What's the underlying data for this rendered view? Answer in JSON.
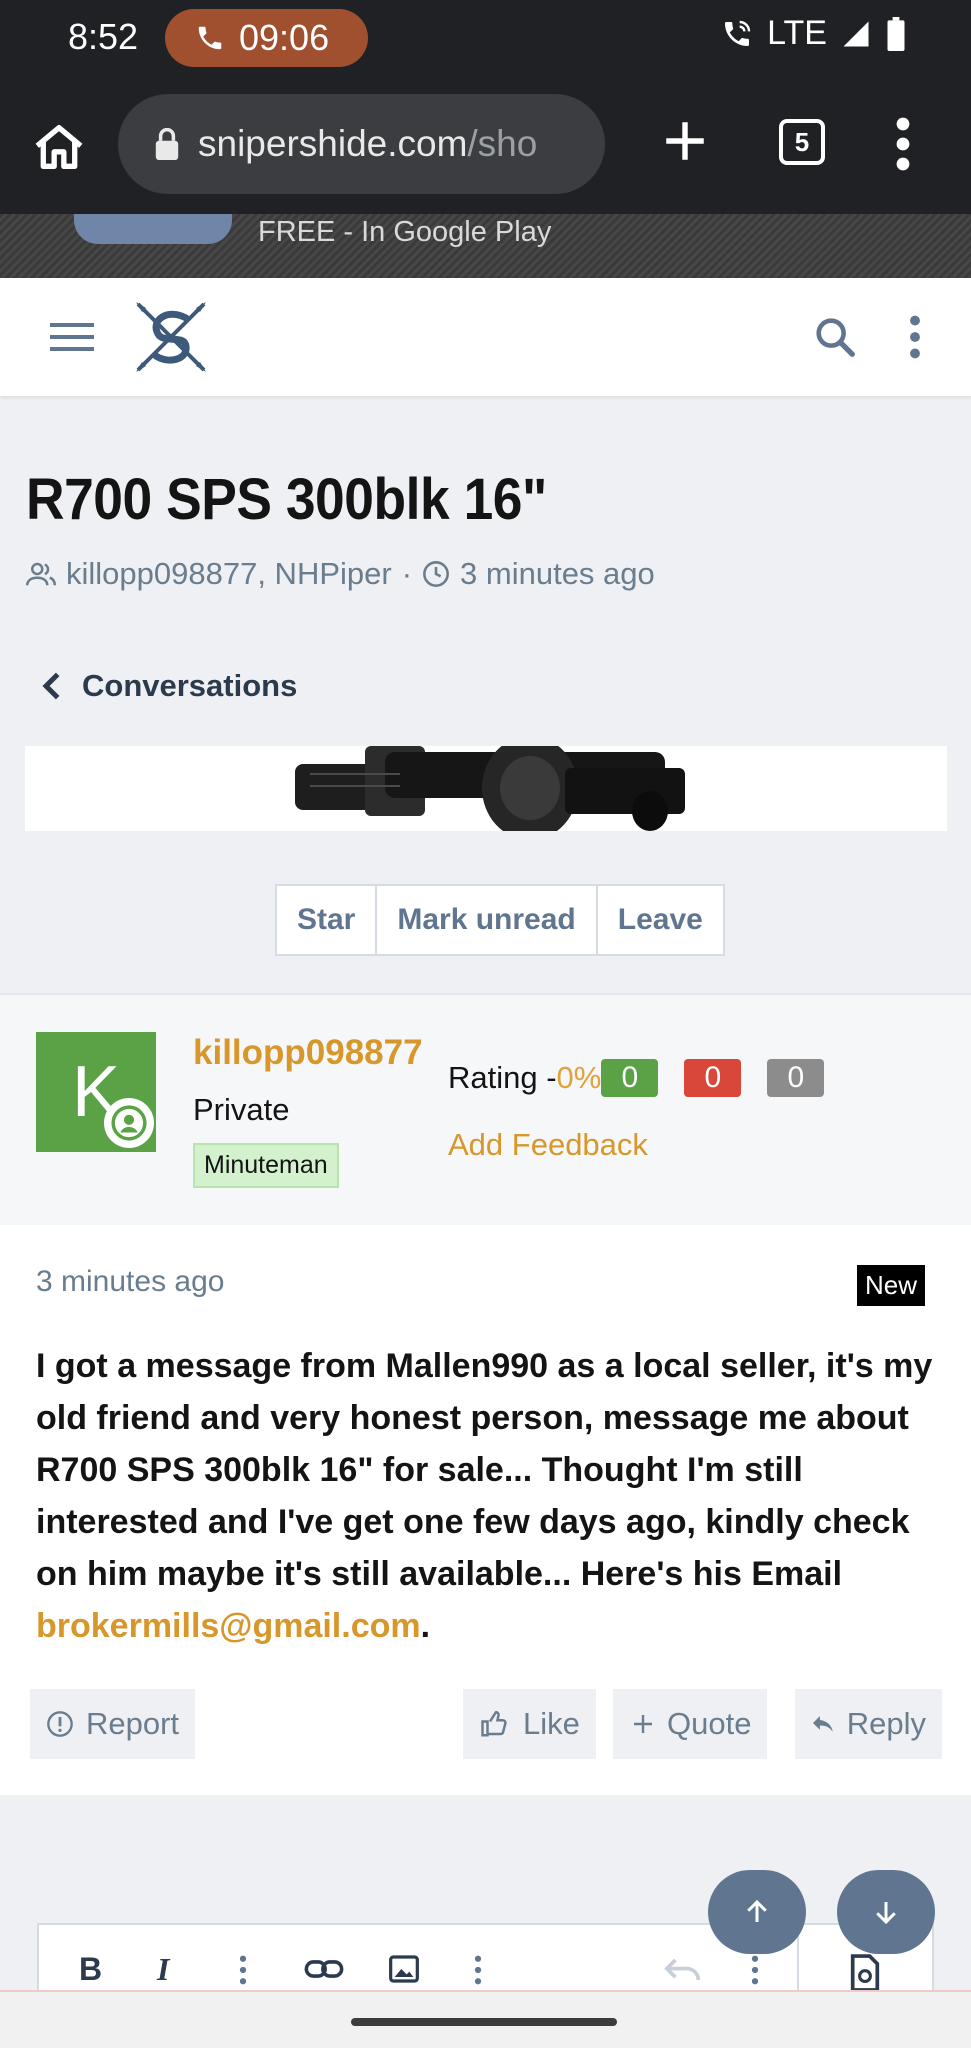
{
  "status_bar": {
    "time": "8:52",
    "call_time": "09:06",
    "network": "LTE"
  },
  "browser": {
    "url_host": "snipershide.com",
    "url_rest": "/sho",
    "tab_count": "5"
  },
  "ad": {
    "text": "FREE - In Google Play"
  },
  "thread": {
    "title": "R700 SPS 300blk 16\"",
    "participants": "killopp098877, NHPiper",
    "separator": "·",
    "time": "3 minutes ago",
    "back_label": "Conversations",
    "buttons": {
      "star": "Star",
      "mark_unread": "Mark unread",
      "leave": "Leave"
    }
  },
  "post": {
    "avatar_letter": "K",
    "username": "killopp098877",
    "rank": "Private",
    "banner": "Minuteman",
    "rating_label": "Rating -",
    "rating_pct": "0%",
    "rating_counts": {
      "positive": "0",
      "negative": "0",
      "neutral": "0"
    },
    "add_feedback": "Add Feedback",
    "time": "3 minutes ago",
    "new_badge": "New",
    "body": "I got a message from Mallen990 as a local seller, it's my old friend and very honest person, message me about R700 SPS 300blk 16\" for sale... Thought I'm still interested and I've get one few days ago, kindly check on him maybe it's still available... Here's his Email ",
    "email": "brokermills@gmail.com",
    "body_end": ".",
    "actions": {
      "report": "Report",
      "like": "Like",
      "quote": "Quote",
      "reply": "Reply"
    }
  },
  "colors": {
    "accent": "#d7972b",
    "positive": "#5aa245",
    "negative": "#d9473a",
    "neutral": "#8c8c8c",
    "button_text": "#5f7590"
  }
}
